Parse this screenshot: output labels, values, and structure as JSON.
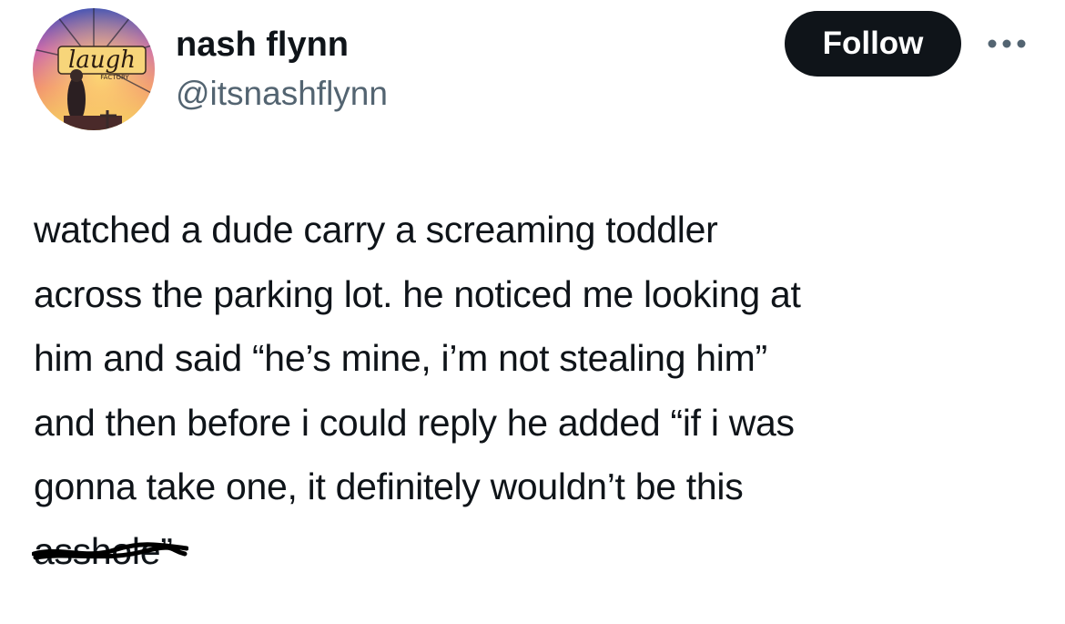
{
  "author": {
    "display_name": "nash flynn",
    "handle": "@itsnashflynn",
    "avatar_logo_text": "laugh",
    "avatar_logo_subtext": "FACTORY"
  },
  "actions": {
    "follow_label": "Follow",
    "more_icon": "more-horizontal-icon"
  },
  "tweet": {
    "lines": [
      "watched a dude carry a screaming toddler",
      "across the parking lot. he noticed me looking at",
      "him and said “he’s mine, i’m not stealing him”",
      "and then before i could reply he added “if i was",
      "gonna take one, it definitely wouldn’t be this"
    ],
    "last_line_censored_word": "asshole",
    "last_line_tail": "”"
  },
  "colors": {
    "text": "#0f1419",
    "secondary_text": "#536471",
    "button_bg": "#0f1419",
    "button_text": "#ffffff"
  }
}
